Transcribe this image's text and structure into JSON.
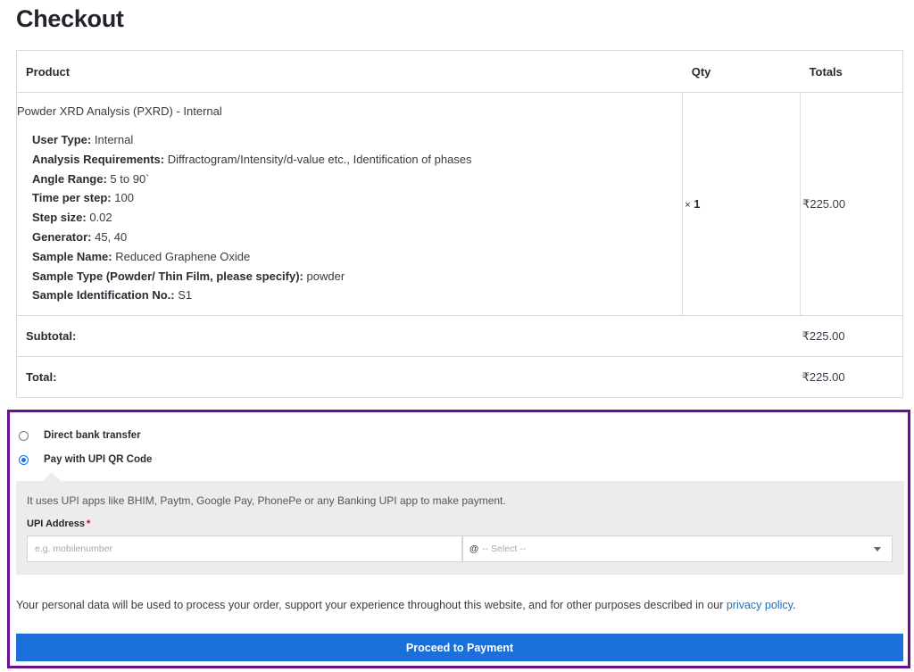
{
  "page": {
    "title": "Checkout"
  },
  "table": {
    "headers": {
      "product": "Product",
      "qty": "Qty",
      "totals": "Totals"
    },
    "item": {
      "name": "Powder XRD Analysis (PXRD) - Internal",
      "meta": [
        {
          "key": "User Type:",
          "value": "Internal"
        },
        {
          "key": "Analysis Requirements:",
          "value": "Diffractogram/Intensity/d-value etc., Identification of phases"
        },
        {
          "key": "Angle Range:",
          "value": "5 to 90`"
        },
        {
          "key": "Time per step:",
          "value": "100"
        },
        {
          "key": "Step size:",
          "value": "0.02"
        },
        {
          "key": "Generator:",
          "value": "45, 40"
        },
        {
          "key": "Sample Name:",
          "value": "Reduced Graphene Oxide"
        },
        {
          "key": "Sample Type (Powder/ Thin Film, please specify):",
          "value": "powder"
        },
        {
          "key": "Sample Identification No.:",
          "value": "S1"
        }
      ],
      "qty_prefix": "×",
      "qty": "1",
      "total": "₹225.00"
    },
    "subtotal": {
      "label": "Subtotal:",
      "value": "₹225.00"
    },
    "total": {
      "label": "Total:",
      "value": "₹225.00"
    }
  },
  "payment": {
    "methods": [
      {
        "label": "Direct bank transfer",
        "selected": false
      },
      {
        "label": "Pay with UPI QR Code",
        "selected": true
      }
    ],
    "upi": {
      "description": "It uses UPI apps like BHIM, Paytm, Google Pay, PhonePe or any Banking UPI app to make payment.",
      "label": "UPI Address",
      "required_mark": "*",
      "placeholder": "e.g. mobilenumber",
      "select_prefix": "@",
      "select_value": "-- Select --"
    },
    "privacy_text": "Your personal data will be used to process your order, support your experience throughout this website, and for other purposes described in our ",
    "privacy_link": "privacy policy",
    "privacy_end": ".",
    "button": "Proceed to Payment",
    "accent": "#6b0f8e",
    "button_color": "#1a6fd9"
  }
}
